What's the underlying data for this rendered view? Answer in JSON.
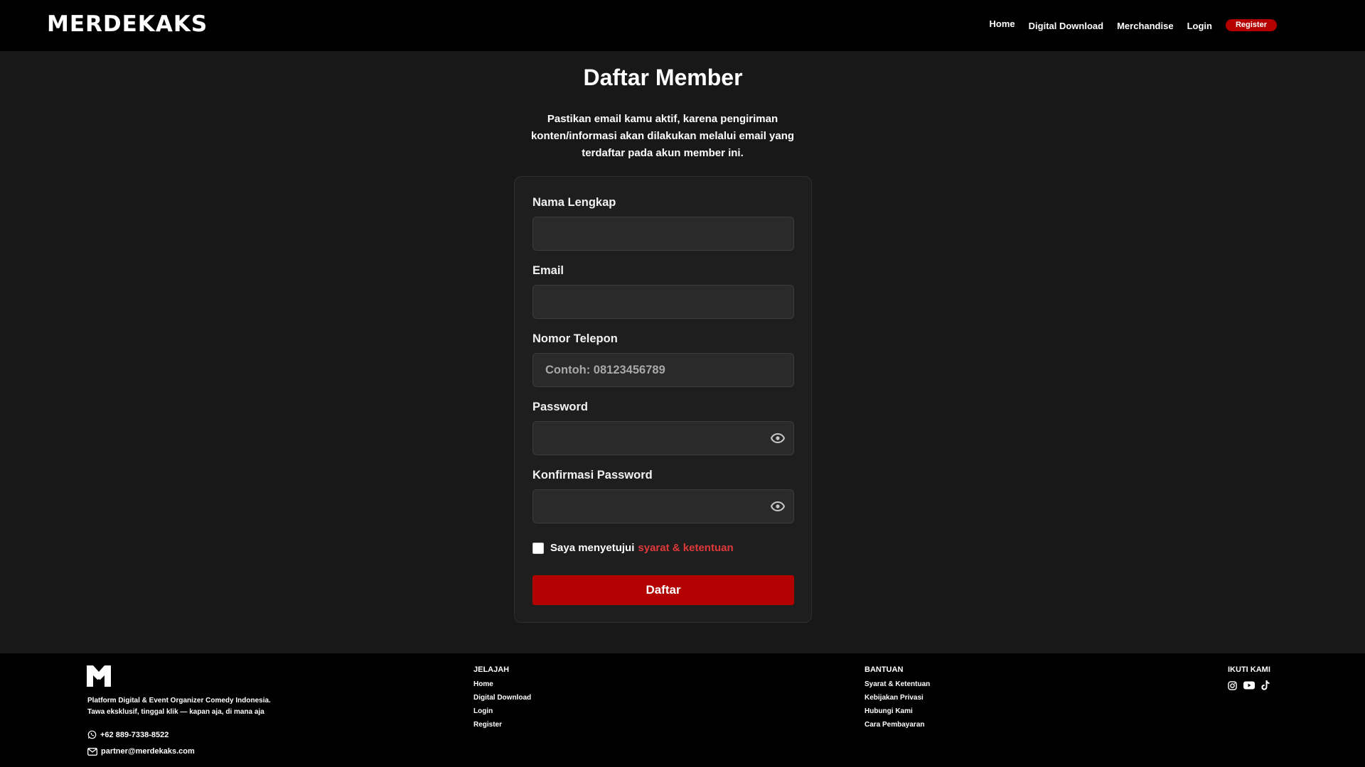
{
  "header": {
    "logo_text": "MERDEKAKS",
    "nav": {
      "home": "Home",
      "digital_download": "Digital Download",
      "merchandise": "Merchandise",
      "login": "Login",
      "register": "Register"
    }
  },
  "main": {
    "title": "Daftar Member",
    "notice": "Pastikan email kamu aktif, karena pengiriman konten/informasi akan dilakukan melalui email yang terdaftar pada akun member ini.",
    "form": {
      "full_name": {
        "label": "Nama Lengkap",
        "value": "",
        "placeholder": ""
      },
      "email": {
        "label": "Email",
        "value": "",
        "placeholder": ""
      },
      "phone": {
        "label": "Nomor Telepon",
        "value": "",
        "placeholder": "Contoh: 08123456789"
      },
      "password": {
        "label": "Password",
        "value": "",
        "placeholder": ""
      },
      "confirm_password": {
        "label": "Konfirmasi Password",
        "value": "",
        "placeholder": ""
      },
      "terms": {
        "text": "Saya menyetujui",
        "link": "syarat & ketentuan",
        "checked": false
      },
      "submit_label": "Daftar"
    }
  },
  "footer": {
    "tagline_1": "Platform Digital & Event Organizer Comedy Indonesia.",
    "tagline_2": "Tawa eksklusif, tinggal klik — kapan aja, di mana aja",
    "phone": "+62 889-7338-8522",
    "email": "partner@merdekaks.com",
    "explore": {
      "heading": "JELAJAH",
      "links": [
        "Home",
        "Digital Download",
        "Login",
        "Register"
      ]
    },
    "help": {
      "heading": "BANTUAN",
      "links": [
        "Syarat & Ketentuan",
        "Kebijakan Privasi",
        "Hubungi Kami",
        "Cara Pembayaran"
      ]
    },
    "follow": {
      "heading": "IKUTI KAMI",
      "icons": [
        "instagram-icon",
        "youtube-icon",
        "tiktok-icon"
      ]
    }
  },
  "colors": {
    "accent": "#b30000",
    "link": "#e0393b",
    "background": "#181818",
    "bar": "#000000"
  }
}
